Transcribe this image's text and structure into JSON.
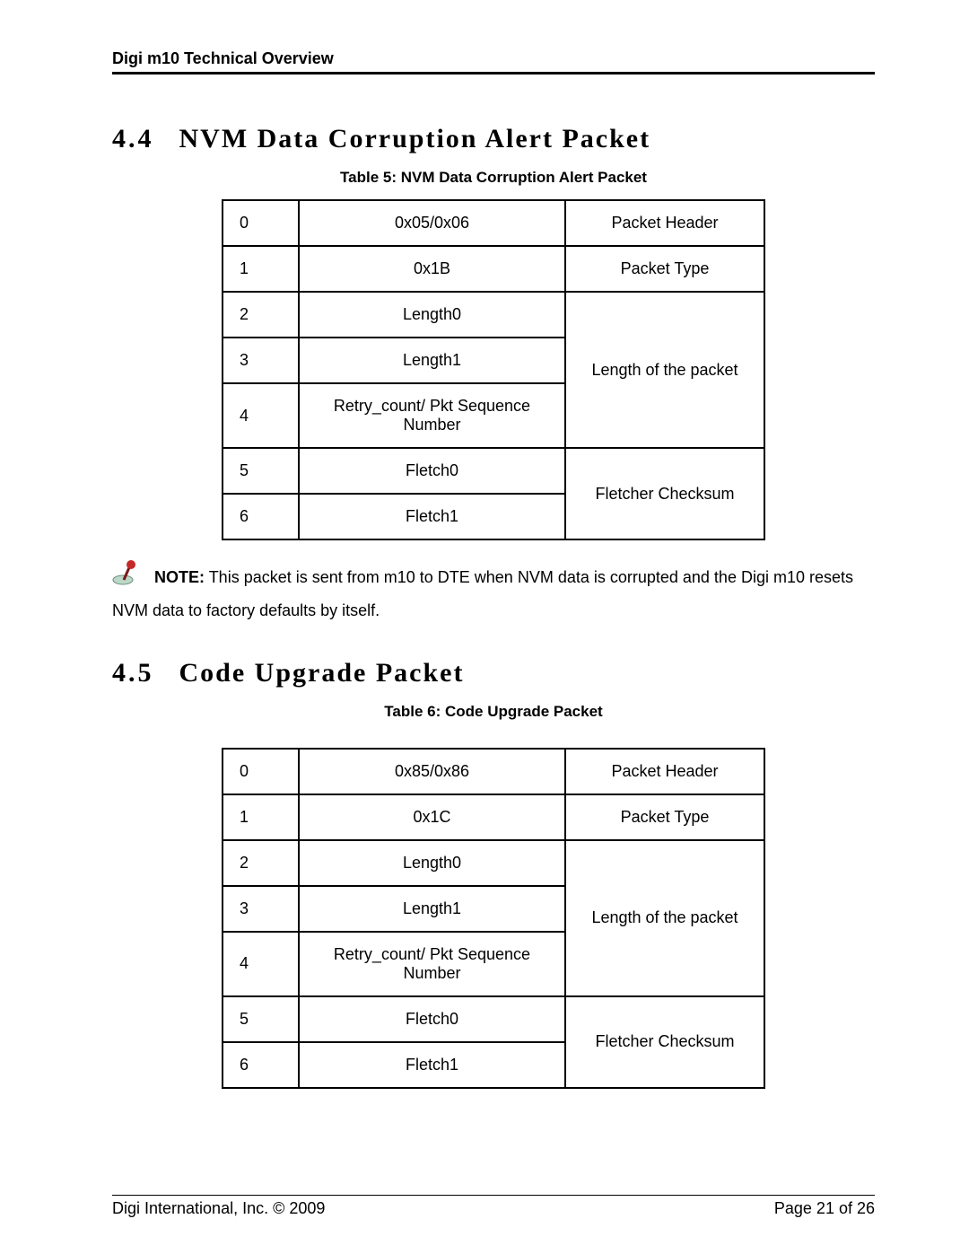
{
  "header": {
    "title": "Digi m10 Technical Overview"
  },
  "section_44": {
    "number": "4.4",
    "title": "NVM Data Corruption Alert Packet",
    "caption": "Table 5: NVM Data Corruption Alert Packet",
    "rows": [
      {
        "idx": "0",
        "field": "0x05/0x06",
        "desc": "Packet Header"
      },
      {
        "idx": "1",
        "field": "0x1B",
        "desc": "Packet Type"
      },
      {
        "idx": "2",
        "field": "Length0",
        "desc": "Length of the packet"
      },
      {
        "idx": "3",
        "field": "Length1"
      },
      {
        "idx": "4",
        "field": "Retry_count/ Pkt Sequence Number"
      },
      {
        "idx": "5",
        "field": "Fletch0",
        "desc": "Fletcher Checksum"
      },
      {
        "idx": "6",
        "field": "Fletch1"
      }
    ]
  },
  "note": {
    "label": "NOTE:",
    "text": " This packet is sent from m10 to DTE when NVM data is corrupted and the Digi m10 resets NVM data to factory defaults by itself."
  },
  "section_45": {
    "number": "4.5",
    "title": "Code Upgrade Packet",
    "caption": "Table 6: Code Upgrade Packet",
    "rows": [
      {
        "idx": "0",
        "field": "0x85/0x86",
        "desc": "Packet Header"
      },
      {
        "idx": "1",
        "field": "0x1C",
        "desc": "Packet Type"
      },
      {
        "idx": "2",
        "field": "Length0",
        "desc": "Length of the packet"
      },
      {
        "idx": "3",
        "field": "Length1"
      },
      {
        "idx": "4",
        "field": "Retry_count/ Pkt Sequence Number"
      },
      {
        "idx": "5",
        "field": "Fletch0",
        "desc": "Fletcher Checksum"
      },
      {
        "idx": "6",
        "field": "Fletch1"
      }
    ]
  },
  "footer": {
    "left": "Digi International, Inc. © 2009",
    "right": "Page 21 of 26"
  }
}
